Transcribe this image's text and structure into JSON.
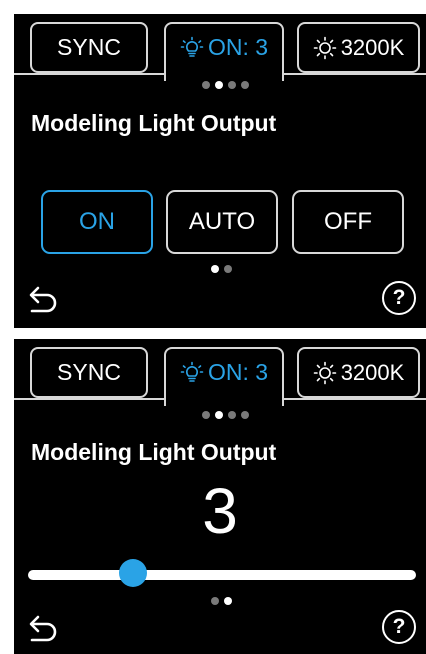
{
  "screens": [
    {
      "tabs": {
        "sync": "SYNC",
        "on": "ON: 3",
        "temp": "3200K"
      },
      "title": "Modeling Light Output",
      "options": [
        "ON",
        "AUTO",
        "OFF"
      ],
      "selected_option": "ON",
      "icons": {
        "bulb": "lightbulb-icon",
        "sun": "sun-icon",
        "back": "back-arrow-icon",
        "help": "help-icon"
      }
    },
    {
      "tabs": {
        "sync": "SYNC",
        "on": "ON: 3",
        "temp": "3200K"
      },
      "title": "Modeling Light Output",
      "value": "3",
      "slider": {
        "fraction": 0.27
      }
    }
  ],
  "colors": {
    "accent": "#2aa3e6",
    "background": "#000000",
    "border": "#d8d8d8"
  }
}
